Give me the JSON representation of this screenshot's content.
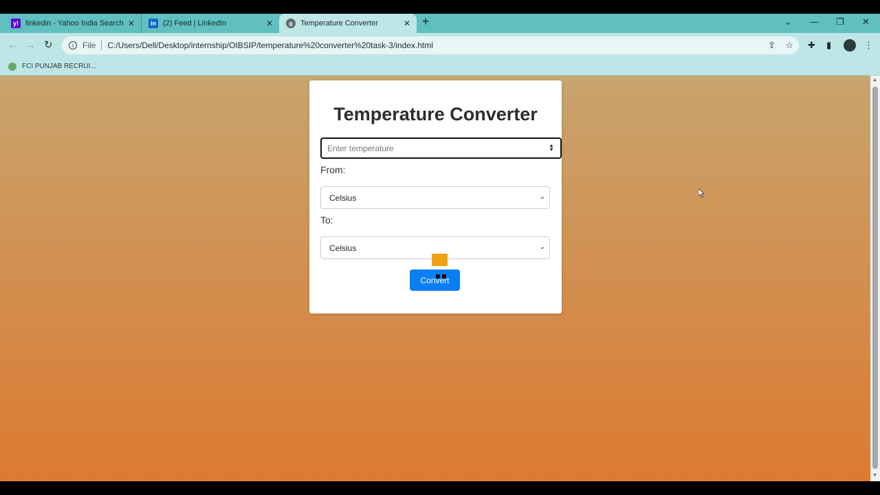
{
  "browser": {
    "tabs": [
      {
        "title": "linkedin - Yahoo India Search Re",
        "favicon": "yahoo-icon",
        "color": "#6001d2"
      },
      {
        "title": "(2) Feed | LinkedIn",
        "favicon": "linkedin-icon",
        "color": "#0a66c2"
      },
      {
        "title": "Temperature Converter",
        "favicon": "globe-icon",
        "color": "#5a6b6b"
      }
    ],
    "new_tab_symbol": "+",
    "url_scheme": "File",
    "url": "C:/Users/Dell/Desktop/internship/OIBSIP/temperature%20converter%20task-3/index.html",
    "bookmark": "FCI PUNJAB RECRUI..."
  },
  "app": {
    "title": "Temperature Converter",
    "input_placeholder": "Enter temperature",
    "from_label": "From:",
    "to_label": "To:",
    "from_selected": "Celsius",
    "to_selected": "Celsius",
    "convert_label": "Convert",
    "accent": "#0a7ef5"
  }
}
